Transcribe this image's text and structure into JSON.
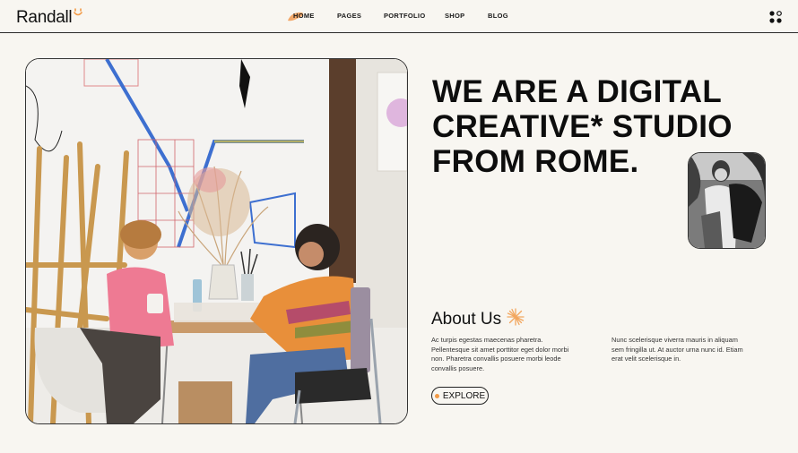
{
  "brand": {
    "name": "Randall",
    "accent": "#f29a46"
  },
  "nav": {
    "items": [
      {
        "label": "HOME",
        "active": true
      },
      {
        "label": "PAGES"
      },
      {
        "label": "PORTFOLIO"
      },
      {
        "label": "SHOP"
      },
      {
        "label": "BLOG"
      }
    ],
    "menu_icon": "grid-dots-icon"
  },
  "hero": {
    "headline_lines": [
      "WE ARE A DIGITAL",
      "CREATIVE* STUDIO",
      "FROM ROME."
    ]
  },
  "about": {
    "title": "About Us",
    "col1": "Ac turpis egestas maecenas pharetra. Pellentesque sit amet porttitor eget dolor morbi non. Pharetra convallis posuere morbi leode convallis posuere.",
    "col2": "Nunc scelerisque viverra mauris in aliquam sem fringilla ut. At auctor urna nunc id. Etiam erat velit scelerisque in.",
    "cta": "EXPLORE"
  }
}
